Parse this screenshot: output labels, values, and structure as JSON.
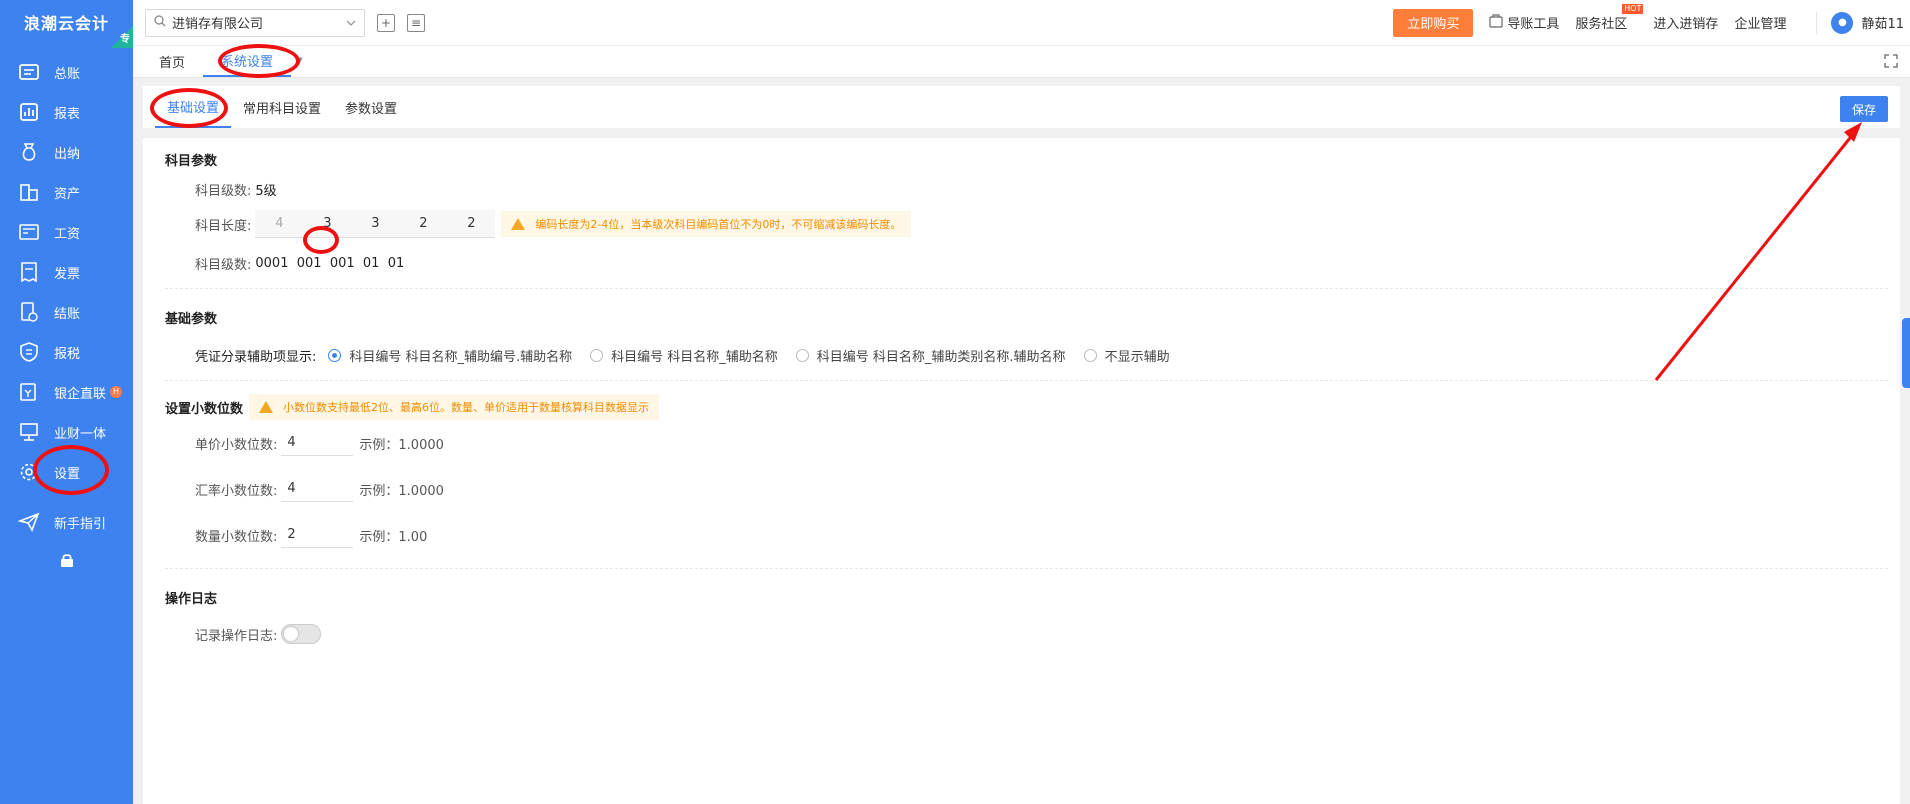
{
  "app": {
    "logo_text": "浪潮云会计",
    "logo_badge": "专"
  },
  "sidebar": {
    "items": [
      {
        "label": "总账",
        "icon": "ledger-icon"
      },
      {
        "label": "报表",
        "icon": "report-icon"
      },
      {
        "label": "出纳",
        "icon": "cashier-icon"
      },
      {
        "label": "资产",
        "icon": "asset-icon"
      },
      {
        "label": "工资",
        "icon": "salary-icon"
      },
      {
        "label": "发票",
        "icon": "invoice-icon"
      },
      {
        "label": "结账",
        "icon": "close-book-icon"
      },
      {
        "label": "报税",
        "icon": "tax-icon"
      },
      {
        "label": "银企直联",
        "icon": "bank-link-icon",
        "hot": "H"
      },
      {
        "label": "业财一体",
        "icon": "biz-finance-icon"
      },
      {
        "label": "设置",
        "icon": "gear-icon"
      },
      {
        "label": "新手指引",
        "icon": "guide-icon"
      }
    ]
  },
  "topbar": {
    "company": "进销存有限公司",
    "buy_label": "立即购买",
    "links": [
      {
        "label": "导账工具"
      },
      {
        "label": "服务社区",
        "tag": "HOT"
      },
      {
        "label": "进入进销存"
      },
      {
        "label": "企业管理"
      }
    ],
    "username": "静茹11"
  },
  "tabs": [
    {
      "label": "首页",
      "active": false
    },
    {
      "label": "系统设置",
      "active": true
    }
  ],
  "subtabs": [
    {
      "label": "基础设置",
      "active": true
    },
    {
      "label": "常用科目设置",
      "active": false
    },
    {
      "label": "参数设置",
      "active": false
    }
  ],
  "save_label": "保存",
  "subject_params": {
    "title": "科目参数",
    "level_label": "科目级数:",
    "level_value": "5级",
    "length_label": "科目长度:",
    "lengths": [
      "4",
      "3",
      "3",
      "2",
      "2"
    ],
    "length_warning": "编码长度为2-4位，当本级次科目编码首位不为0时，不可缩减该编码长度。",
    "code_label": "科目级数:",
    "code_value": "0001  001  001  01  01"
  },
  "basic_params": {
    "title": "基础参数",
    "voucher_label": "凭证分录辅助项显示:",
    "options": [
      {
        "label": "科目编号 科目名称_辅助编号.辅助名称",
        "checked": true
      },
      {
        "label": "科目编号 科目名称_辅助名称",
        "checked": false
      },
      {
        "label": "科目编号 科目名称_辅助类别名称.辅助名称",
        "checked": false
      },
      {
        "label": "不显示辅助",
        "checked": false
      }
    ]
  },
  "decimals": {
    "title": "设置小数位数",
    "warning": "小数位数支持最低2位、最高6位。数量、单价适用于数量核算科目数据显示",
    "rows": [
      {
        "label": "单价小数位数:",
        "value": "4",
        "example": "示例：1.0000"
      },
      {
        "label": "汇率小数位数:",
        "value": "4",
        "example": "示例：1.0000"
      },
      {
        "label": "数量小数位数:",
        "value": "2",
        "example": "示例：1.00"
      }
    ]
  },
  "op_log": {
    "title": "操作日志",
    "label": "记录操作日志:",
    "enabled": false
  }
}
